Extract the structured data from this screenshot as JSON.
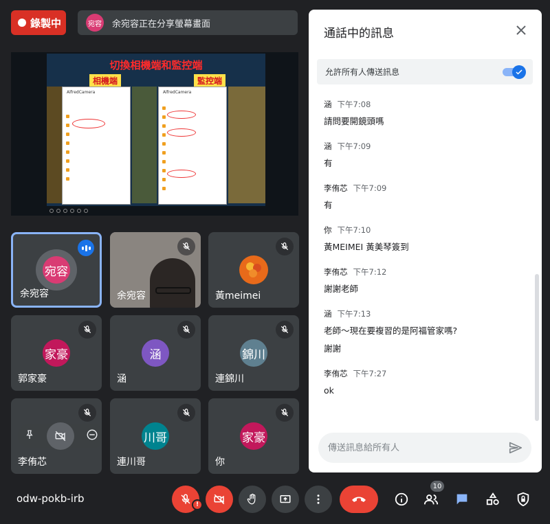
{
  "recording": {
    "label": "錄製中"
  },
  "share_banner": {
    "avatar_text": "宛容",
    "text": "余宛容正在分享螢幕畫面"
  },
  "presentation": {
    "title": "切換相機端和監控端",
    "left_label": "相機端",
    "right_label": "監控端",
    "brand": "AlfredCamera"
  },
  "tiles": [
    {
      "name": "余宛容",
      "avatar": "宛容",
      "color": "#d93b73",
      "speaking": true
    },
    {
      "name": "余宛容",
      "muted": true,
      "video": true
    },
    {
      "name": "黃meimei",
      "muted": true,
      "photo_avatar": true
    },
    {
      "name": "郭家豪",
      "avatar": "家豪",
      "color": "#c2185b",
      "muted": true
    },
    {
      "name": "涵",
      "avatar": "涵",
      "color": "#7e57c2",
      "muted": true
    },
    {
      "name": "連錦川",
      "avatar": "錦川",
      "color": "#5f8090",
      "muted": true
    },
    {
      "name": "李侑芯",
      "muted": true,
      "hover": true
    },
    {
      "name": "連川哥",
      "avatar": "川哥",
      "color": "#00838f",
      "muted": true
    },
    {
      "name": "你",
      "avatar": "家豪",
      "color": "#c2185b",
      "muted": true
    }
  ],
  "chat": {
    "title": "通話中的訊息",
    "allow_label": "允許所有人傳送訊息",
    "allow_enabled": true,
    "input_placeholder": "傳送訊息給所有人",
    "messages": [
      {
        "sender": "涵",
        "time": "下午7:08",
        "lines": [
          "請問要開鏡頭嗎"
        ]
      },
      {
        "sender": "涵",
        "time": "下午7:09",
        "lines": [
          "有"
        ]
      },
      {
        "sender": "李侑芯",
        "time": "下午7:09",
        "lines": [
          "有"
        ]
      },
      {
        "sender": "你",
        "time": "下午7:10",
        "lines": [
          "黃MEIMEI 黃美琴簽到"
        ]
      },
      {
        "sender": "李侑芯",
        "time": "下午7:12",
        "lines": [
          "謝謝老師"
        ]
      },
      {
        "sender": "涵",
        "time": "下午7:13",
        "lines": [
          "老師～現在要複習的是阿福管家嗎?",
          "謝謝"
        ]
      },
      {
        "sender": "李侑芯",
        "time": "下午7:27",
        "lines": [
          "ok"
        ]
      }
    ]
  },
  "bottom_bar": {
    "meeting_code": "odw-pokb-irb",
    "participants_count": "10",
    "mic_warning": "!"
  }
}
